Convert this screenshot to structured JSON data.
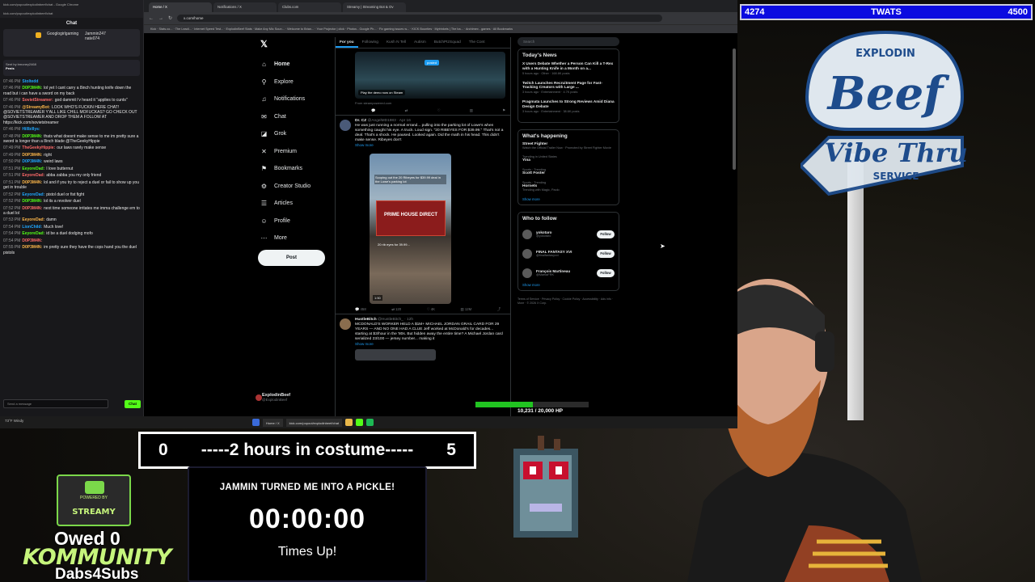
{
  "chat": {
    "window_title": "kick.com/popout/explodinbeef/chat - Google Chrome",
    "url": "kick.com/popout/explodinbeef/chat",
    "header": "Chat",
    "pinned": {
      "user1": "Googlogirlgaming",
      "user2": "Jammin247",
      "user3": "nate074"
    },
    "sent_by": "Sent by bmoney2468",
    "sent_text": "Penis",
    "messages": [
      {
        "time": "07:46 PM",
        "user": "Stoltedd",
        "text": ""
      },
      {
        "time": "07:46 PM",
        "user": "D0P3M4N:",
        "text": "lol yet I cant carry a 8inch hunting knife down the road but i can have a sword on my back"
      },
      {
        "time": "07:46 PM",
        "user": "SovietStreamer:",
        "text": "god dammit i'v heard it \"applies to cunts\""
      },
      {
        "time": "07:46 PM",
        "user": "@StreamyBot:",
        "text": "LOOK WHO'S FUCKIN HERE CHAT! @SOVIETSTREAMER Y'ALL LIKE CHILL MOFUCKAS? GO CHECK OUT @SOVIETSTREAMER AND DROP THEM A FOLLOW AT https://kick.com/sovietstreamer"
      },
      {
        "time": "07:46 PM",
        "user": "Hillbillys:",
        "text": ""
      },
      {
        "time": "07:48 PM",
        "user": "D0P3M4N:",
        "text": "thats what doesnt make sense to me im pretty sure a sword is longer than a 8inch blade @TheGeekyHippie"
      },
      {
        "time": "07:49 PM",
        "user": "TheGeekyHippie:",
        "text": "our laws rarely make sense"
      },
      {
        "time": "07:49 PM",
        "user": "D0P3M4N:",
        "text": "right"
      },
      {
        "time": "07:50 PM",
        "user": "D0P3M4N:",
        "text": "weird laws"
      },
      {
        "time": "07:51 PM",
        "user": "EeyoreDad:",
        "text": "I love butternut"
      },
      {
        "time": "07:51 PM",
        "user": "EeyoreDad:",
        "text": "abba zabba you my only friend"
      },
      {
        "time": "07:51 PM",
        "user": "D0P3M4N:",
        "text": "lol and if you try to reject a duel or fail to show up you get in trouble"
      },
      {
        "time": "07:52 PM",
        "user": "EeyoreDad:",
        "text": "pistol duel or fist fight"
      },
      {
        "time": "07:52 PM",
        "user": "D0P3M4N:",
        "text": "lol its a revolver duel"
      },
      {
        "time": "07:52 PM",
        "user": "D0P3M4N:",
        "text": "next time someone irritates me imma challenge em to a duel lol"
      },
      {
        "time": "07:53 PM",
        "user": "EeyoreDad:",
        "text": "damn"
      },
      {
        "time": "07:54 PM",
        "user": "LionChild:",
        "text": "Much love!"
      },
      {
        "time": "07:54 PM",
        "user": "EeyoreDad:",
        "text": "id be a duel dodging mofo"
      },
      {
        "time": "07:54 PM",
        "user": "D0P3M4N:",
        "text": ""
      },
      {
        "time": "07:55 PM",
        "user": "D0P3M4N:",
        "text": "im pretty sure they have the cops hand you the duel pistols"
      }
    ],
    "input_placeholder": "Send a message",
    "chat_button": "Chat",
    "weather": "73°F Windy"
  },
  "browser": {
    "tabs": [
      "Home / X",
      "Notifications / X",
      "Clubs.com",
      "Streamy | Streaming Bot & Ov"
    ],
    "url": "x.com/home",
    "bookmarks": "Kick · Stats.co... · The Leadi... · Internet Speed Test... · ExplodinBeef Stats · Make Any Mic Soun... · Welcome to Brian... · Your Projector | click · Photos - Google Ph... · Fix gaming issues w... · KICK Bounties · Mytrinkets | The ba... · Archimex - games · All Bookmarks"
  },
  "x": {
    "nav": [
      {
        "icon": "home-icon",
        "glyph": "⌂",
        "label": "Home"
      },
      {
        "icon": "explore-icon",
        "glyph": "⚲",
        "label": "Explore"
      },
      {
        "icon": "bell-icon",
        "glyph": "♫",
        "label": "Notifications"
      },
      {
        "icon": "chat-icon",
        "glyph": "✉",
        "label": "Chat"
      },
      {
        "icon": "grok-icon",
        "glyph": "◪",
        "label": "Grok"
      },
      {
        "icon": "premium-icon",
        "glyph": "✕",
        "label": "Premium"
      },
      {
        "icon": "bookmark-icon",
        "glyph": "⚑",
        "label": "Bookmarks"
      },
      {
        "icon": "creator-icon",
        "glyph": "⚙",
        "label": "Creator Studio"
      },
      {
        "icon": "articles-icon",
        "glyph": "☰",
        "label": "Articles"
      },
      {
        "icon": "profile-icon",
        "glyph": "☺",
        "label": "Profile"
      },
      {
        "icon": "more-icon",
        "glyph": "⋯",
        "label": "More"
      }
    ],
    "post_button": "Post",
    "profile": {
      "name": "ExplodinBeef",
      "handle": "@ExplodinBeef"
    },
    "feed_tabs": [
      "For you",
      "Following",
      "Kush N Tell",
      "Autism",
      "ButchPtzSquad",
      "The Cont"
    ],
    "promo": {
      "caption": "Play the demo now on Steam",
      "badge": "posted",
      "from": "From steampowered.com"
    },
    "tweet1": {
      "name": "Dr. CZ",
      "handle": "@AngelMD1983 · Apr 16",
      "body": "He was just running a normal errand... pulling into the parking lot of Lowe's when something caught his eye. A truck. Loud sign. \"20 RIBEYES FOR $39.99.\" That's not a deal. That's a shock. He paused. Looked again. Did the math in his head. This didn't make sense. Ribeyes don't",
      "more": "Show more",
      "img_caption": "Scoping out the 20 Ribeyes for $39.99 deal in the Lowe's parking lot",
      "truck_text": "PRIME HOUSE DIRECT",
      "img_caption2": "20 rib eyes for 39.99...",
      "duration": "1:50",
      "stats": [
        "458",
        "120",
        "4K",
        "12M"
      ]
    },
    "tweet2": {
      "name": "HustleBitch",
      "handle": "@HustleBitch_ · 12h",
      "body": "MCDONALD'S WORKER HELD A $1M+ MICHAEL JORDAN GRAIL CARD FOR 29 YEARS — AND NO ONE HAD A CLUE Jeff worked at McDonald's for decades... starting at $3/hour in the '80s. But hidden away the entire time? A Michael Jordan card serialized 23/100 — jersey number... making it",
      "more": "Show more"
    },
    "search_placeholder": "Search",
    "todays_news": {
      "title": "Today's News",
      "items": [
        {
          "title": "X Users Debate Whether a Person Can Kill a T-Rex with a Hunting Knife in a Month on a...",
          "meta": "5 hours ago · Other · 168.6K posts"
        },
        {
          "title": "Twitch Launches Recruitment Page for Fast-Tracking Creators with Large ...",
          "meta": "3 hours ago · Entertainment · 4.7K posts"
        },
        {
          "title": "Pragmata Launches to Strong Reviews Amid Diana Design Debate",
          "meta": "3 hours ago · Entertainment · 38.6K posts"
        }
      ]
    },
    "whats_happening": {
      "title": "What's happening",
      "items": [
        {
          "cat": "",
          "name": "Street Fighter",
          "sub": "Watch the Official Trailer Now · Promoted by Street Fighter Movie"
        },
        {
          "cat": "Trending in United States",
          "name": "Yina",
          "sub": ""
        },
        {
          "cat": "Sports · Trending",
          "name": "Scott Foster",
          "sub": ""
        },
        {
          "cat": "Sports · Trending",
          "name": "Hornets",
          "sub": "Trending with Magic, Paolo"
        }
      ],
      "show_more": "Show more"
    },
    "who_to_follow": {
      "title": "Who to follow",
      "items": [
        {
          "name": "yokotaro",
          "handle": "@yokotaro",
          "btn": "Follow"
        },
        {
          "name": "FINAL FANTASY XVI",
          "handle": "@finalfantasyxvi",
          "btn": "Follow"
        },
        {
          "name": "François Martineau",
          "handle": "@MartiaFRK",
          "btn": "Follow"
        }
      ],
      "show_more": "Show more"
    },
    "footer": "Terms of Service · Privacy Policy · Cookie Policy · Accessibility · Ads info · More · © 2026 X Corp."
  },
  "overlay": {
    "top_left_num": "4274",
    "top_title": "TWATS",
    "top_right_num": "4500",
    "logo_top": "EXPLODIN",
    "logo_main": "Beef",
    "logo_line2": "Vibe Thru",
    "logo_sub": "SERVICE",
    "hp_text": "10,231 / 20,000 HP",
    "hp_fraction": 0.51,
    "costume_left": "0",
    "costume_label": "-----2 hours in costume-----",
    "costume_right": "5",
    "timer_title": "JAMMIN TURNED ME INTO A PICKLE!",
    "timer_value": "00:00:00",
    "timer_done": "Times Up!",
    "badge_powered": "POWERED BY",
    "badge_name": "STREAMY",
    "owed": "Owed 0",
    "kommunity": "KOMMUNITY",
    "dabs": "Dabs4Subs"
  },
  "colors": {
    "accent_blue": "#1d9bf0",
    "kick_green": "#53fc18",
    "hp_green": "#21c421",
    "topbar_blue": "#0b0be0"
  }
}
